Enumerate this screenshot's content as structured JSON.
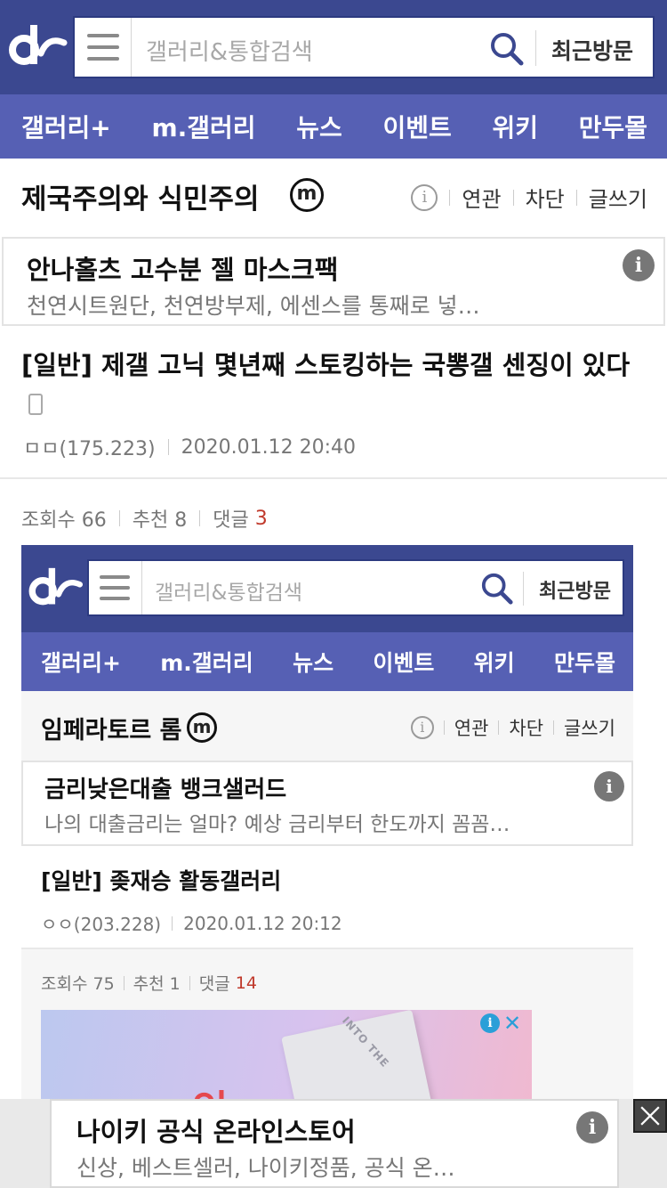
{
  "header": {
    "search_placeholder": "갤러리&통합검색",
    "recent_label": "최근방문"
  },
  "nav": [
    "갤러리+",
    "m.갤러리",
    "뉴스",
    "이벤트",
    "위키",
    "만두몰"
  ],
  "gallery": {
    "title": "제국주의와 식민주의",
    "badge": "m",
    "info": "i",
    "tools": [
      "연관",
      "차단",
      "글쓰기"
    ]
  },
  "ad_top": {
    "title": "안나홀츠 고수분 젤 마스크팩",
    "desc": "천연시트원단, 천연방부제, 에센스를 통째로 넣…",
    "info": "i"
  },
  "post": {
    "title": "[일반] 제갤 고닉 몇년째 스토킹하는 국뽕갤 센징이 있다",
    "author": "ㅁㅁ(175.223)",
    "date": "2020.01.12 20:40",
    "views": "조회수 66",
    "recommend": "추천 8",
    "comments_label": "댓글",
    "comments_count": "3"
  },
  "embedded": {
    "search_placeholder": "갤러리&통합검색",
    "recent_label": "최근방문",
    "nav": [
      "갤러리+",
      "m.갤러리",
      "뉴스",
      "이벤트",
      "위키",
      "만두몰"
    ],
    "gallery_title": "임페라토르 롬",
    "badge": "m",
    "info": "i",
    "tools": [
      "연관",
      "차단",
      "글쓰기"
    ],
    "ad": {
      "title": "금리낮은대출 뱅크샐러드",
      "desc": "나의 대출금리는 얼마? 예상 금리부터 한도까지 꼼꼼…",
      "info": "i"
    },
    "post": {
      "title": "[일반] 좆재승 활동갤러리",
      "author": "ㅇㅇ(203.228)",
      "date": "2020.01.12 20:12",
      "views": "조회수 75",
      "recommend": "추천 1",
      "comments_label": "댓글",
      "comments_count": "14"
    },
    "image_text": "인",
    "book_text": "INTO THE",
    "adchoice_info": "i",
    "adchoice_close": "✕"
  },
  "ad_bottom": {
    "title": "나이키 공식 온라인스토어",
    "desc": "신상, 베스트셀러, 나이키정품, 공식 온…",
    "info": "i"
  },
  "colors": {
    "header_bg": "#3b4890",
    "nav_bg": "#5660b4",
    "comment_count": "#c0392b"
  }
}
